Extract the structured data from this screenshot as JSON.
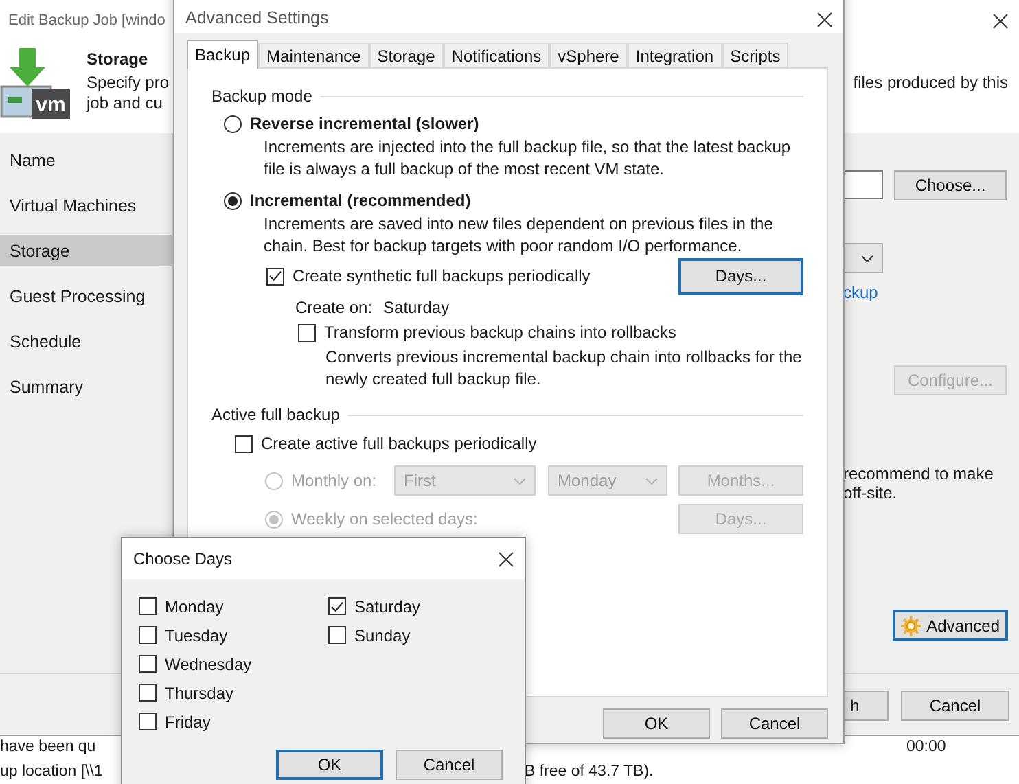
{
  "wizard": {
    "title": "Edit Backup Job [windo",
    "logo_text": "vm",
    "header_title": "Storage",
    "header_lines": [
      "Specify pro",
      "job and cu"
    ],
    "header_right": "files produced by this",
    "steps": [
      {
        "label": "Name",
        "selected": false
      },
      {
        "label": "Virtual Machines",
        "selected": false
      },
      {
        "label": "Storage",
        "selected": true
      },
      {
        "label": "Guest Processing",
        "selected": false
      },
      {
        "label": "Schedule",
        "selected": false
      },
      {
        "label": "Summary",
        "selected": false
      }
    ],
    "choose_button": "Choose...",
    "link": "ckup",
    "configure_button": {
      "label": "Configure...",
      "disabled": true
    },
    "note_lines": [
      "recommend to make",
      "off-site."
    ],
    "advanced_button": {
      "label": "Advanced",
      "focused": true
    },
    "footer_buttons": [
      "h",
      "Cancel"
    ]
  },
  "log": [
    {
      "text": "have been qu",
      "time": "00:00"
    },
    {
      "text": "up location [\\\\1",
      "detail": "B free of 43.7 TB)."
    }
  ],
  "advanced_settings": {
    "title": "Advanced Settings",
    "tabs": [
      {
        "label": "Backup",
        "selected": true
      },
      {
        "label": "Maintenance",
        "selected": false
      },
      {
        "label": "Storage",
        "selected": false
      },
      {
        "label": "Notifications",
        "selected": false
      },
      {
        "label": "vSphere",
        "selected": false
      },
      {
        "label": "Integration",
        "selected": false
      },
      {
        "label": "Scripts",
        "selected": false
      }
    ],
    "backup_mode": {
      "label": "Backup mode",
      "options": [
        {
          "label": "Reverse incremental (slower)",
          "selected": false,
          "description": "Increments are injected into the full backup file, so that the latest backup file is always a full backup of the most recent VM state."
        },
        {
          "label": "Incremental (recommended)",
          "selected": true,
          "description": "Increments are saved into new files dependent on previous files in the chain. Best for backup targets with poor random I/O performance."
        }
      ],
      "synthetic": {
        "label": "Create synthetic full backups periodically",
        "checked": true,
        "button": {
          "label": "Days...",
          "focused": true
        },
        "create_on_label": "Create on:",
        "create_on_value": "Saturday"
      },
      "transform": {
        "label": "Transform previous backup chains into rollbacks",
        "checked": false,
        "description": "Converts previous incremental backup chain into rollbacks for the newly created full backup file."
      }
    },
    "active_full": {
      "label": "Active full backup",
      "checkbox": {
        "label": "Create active full backups periodically",
        "checked": false
      },
      "disabled": true,
      "monthly": {
        "label": "Monthly on:",
        "selected": false,
        "dropdowns": [
          "First",
          "Monday"
        ],
        "button": "Months..."
      },
      "weekly": {
        "label": "Weekly on selected days:",
        "selected": true,
        "button": "Days..."
      }
    },
    "buttons": [
      "OK",
      "Cancel"
    ]
  },
  "choose_days": {
    "title": "Choose Days",
    "days": [
      {
        "label": "Monday",
        "checked": false
      },
      {
        "label": "Tuesday",
        "checked": false
      },
      {
        "label": "Wednesday",
        "checked": false
      },
      {
        "label": "Thursday",
        "checked": false
      },
      {
        "label": "Friday",
        "checked": false
      },
      {
        "label": "Saturday",
        "checked": true
      },
      {
        "label": "Sunday",
        "checked": false
      }
    ],
    "buttons": [
      {
        "label": "OK",
        "focused": true
      },
      {
        "label": "Cancel",
        "focused": false
      }
    ]
  }
}
